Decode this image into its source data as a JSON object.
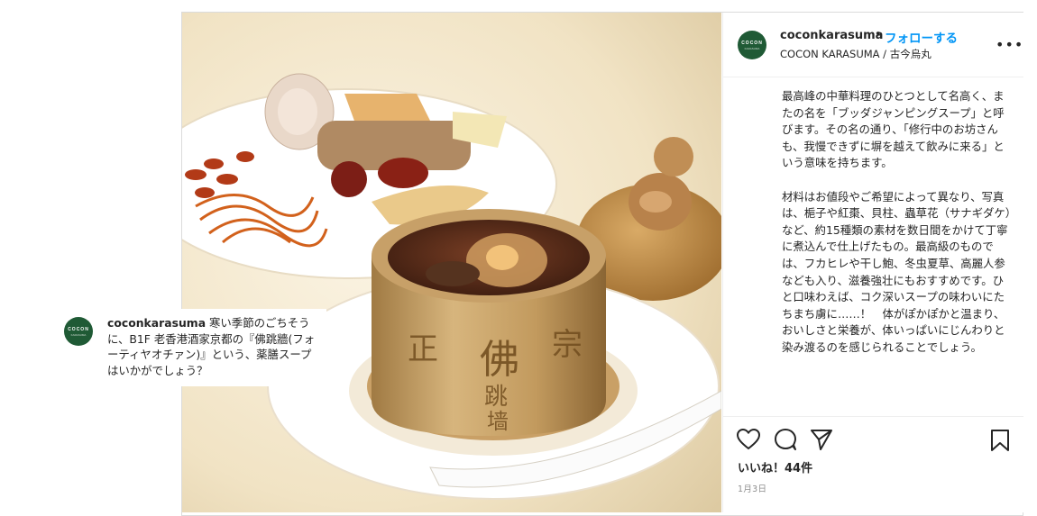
{
  "account": {
    "username": "coconkarasuma",
    "avatar_line1": "COCON",
    "avatar_line2": "KARASUMA"
  },
  "header": {
    "separator": "•",
    "follow_label": "フォローする",
    "location": "COCON KARASUMA / 古今烏丸",
    "more_icon": "•••"
  },
  "caption": "最高峰の中華料理のひとつとして名高く、またの名を「ブッダジャンピングスープ」と呼びます。その名の通り、「修行中のお坊さんも、我慢できずに塀を越えて飲みに来る」という意味を持ちます。\n\n材料はお値段やご希望によって異なり、写真は、梔子や紅棗、貝柱、蟲草花（サナギダケ）など、約15種類の素材を数日間をかけて丁寧に煮込んで仕上げたもの。最高級のものでは、フカヒレや干し鮑、冬虫夏草、高麗人参なども入り、滋養強壮にもおすすめです。ひと口味わえば、コク深いスープの味わいにたちまち虜に……！　体がぽかぽかと温まり、おいしさと栄養が、体いっぱいにじんわりと染み渡るのを感じられることでしょう。",
  "footer": {
    "likes": "いいね！44件",
    "date": "1月3日"
  },
  "tooltip": {
    "text": "寒い季節のごちそうに、B1F 老香港酒家京都の『佛跳牆(フォーティヤオチァン)』という、薬膳スープはいかがでしょう？"
  },
  "photo": {
    "cup_text_left": "正",
    "cup_text_center": "佛",
    "cup_text_center2": "跳",
    "cup_text_center3": "墙",
    "cup_text_right": "宗"
  },
  "icons": {
    "like": "heart-icon",
    "comment": "comment-icon",
    "share": "share-icon",
    "save": "bookmark-icon"
  },
  "colors": {
    "follow": "#0095f6",
    "avatar_bg": "#1f5a35"
  }
}
